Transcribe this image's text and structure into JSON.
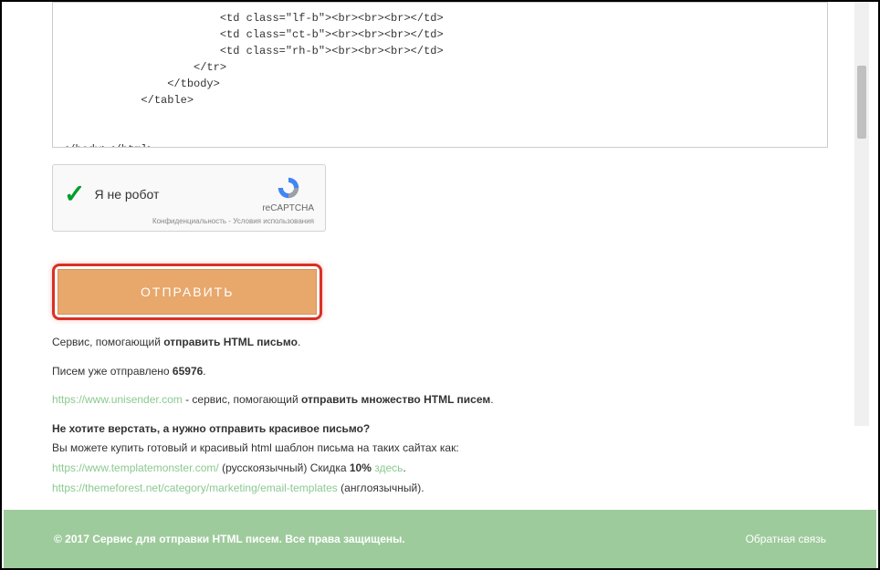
{
  "codeContent": "                        <td class=\"lf-b\"><br><br><br></td>\n                        <td class=\"ct-b\"><br><br><br></td>\n                        <td class=\"rh-b\"><br><br><br></td>\n                    </tr>\n                </tbody>\n            </table>\n        \n    \n</body></html>",
  "recaptcha": {
    "label": "Я не робот",
    "brand": "reCAPTCHA",
    "terms": "Конфиденциальность - Условия использования"
  },
  "submitButton": "ОТПРАВИТЬ",
  "info": {
    "line1_pre": "Сервис, помогающий ",
    "line1_bold": "отправить HTML письмо",
    "line2_pre": "Писем уже отправлено ",
    "line2_count": "65976",
    "line3_link": "https://www.unisender.com",
    "line3_mid": " - сервис, помогающий ",
    "line3_bold": "отправить множество HTML писем",
    "heading": "Не хотите верстать, а нужно отправить красивое письмо?",
    "line4": "Вы можете купить готовый и красивый html шаблон письма на таких сайтах как:",
    "link_tm": "https://www.templatemonster.com/",
    "tm_suffix": " (русскоязычный) Скидка ",
    "tm_discount": "10%",
    "tm_here": " здесь",
    "link_tf": "https://themeforest.net/category/marketing/email-templates",
    "tf_suffix": " (англоязычный)."
  },
  "footer": {
    "copyright": "© 2017 Сервис для отправки HTML писем. Все права защищены.",
    "feedback": "Обратная связь"
  }
}
